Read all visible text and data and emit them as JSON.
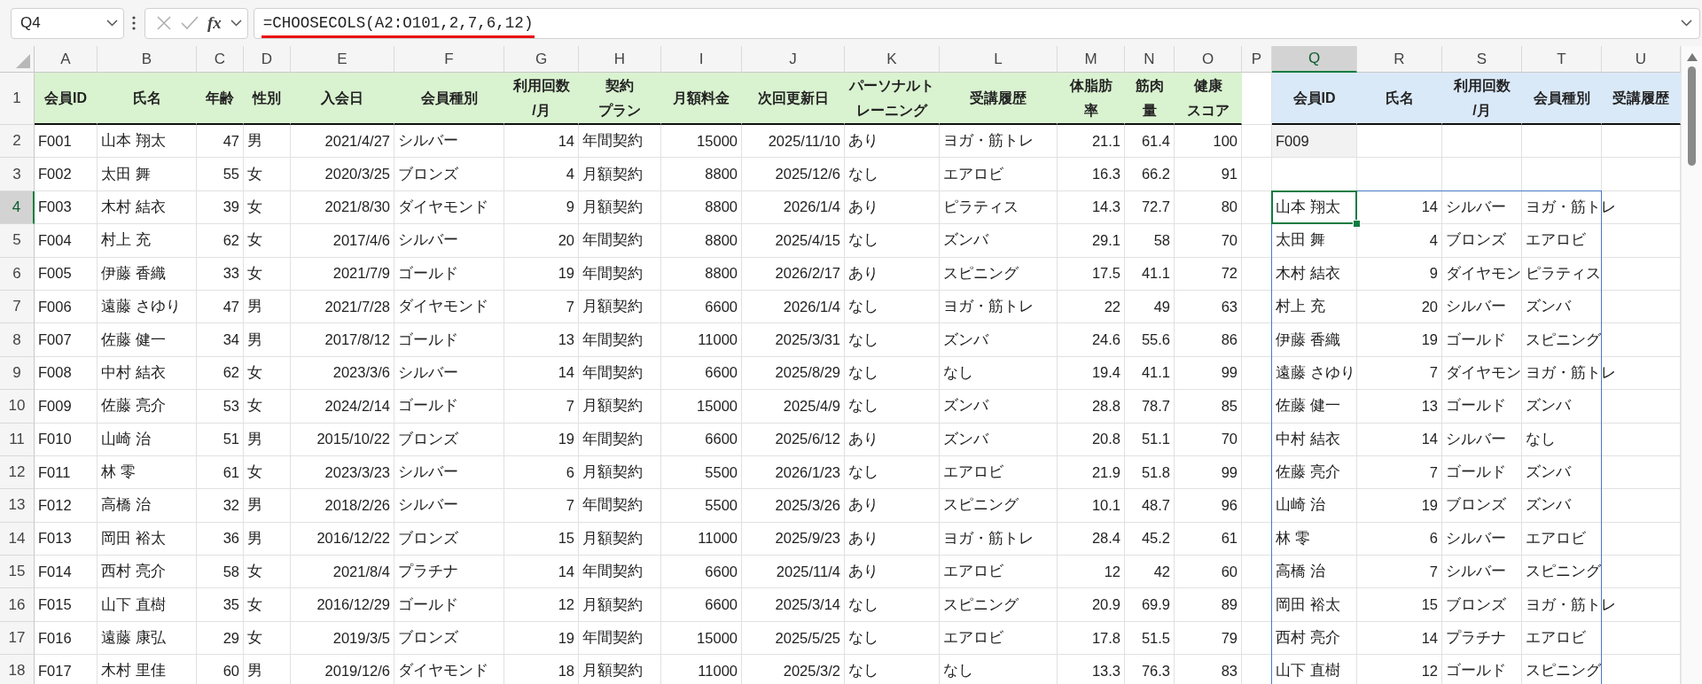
{
  "name_box": {
    "value": "Q4"
  },
  "formula_bar": {
    "function_label": "fx",
    "formula": "=CHOOSECOLS(A2:O101,2,7,6,12)",
    "underlined": true
  },
  "sheet": {
    "columns": [
      {
        "label": "A",
        "selected": false,
        "kind": "text",
        "color": "#d9f2d0"
      },
      {
        "label": "B",
        "selected": false,
        "kind": "text",
        "color": "#d9f2d0"
      },
      {
        "label": "C",
        "selected": false,
        "kind": "number",
        "color": "#d9f2d0"
      },
      {
        "label": "D",
        "selected": false,
        "kind": "text",
        "color": "#d9f2d0"
      },
      {
        "label": "E",
        "selected": false,
        "kind": "number",
        "color": "#d9f2d0"
      },
      {
        "label": "F",
        "selected": false,
        "kind": "text",
        "color": "#d9f2d0"
      },
      {
        "label": "G",
        "selected": false,
        "kind": "number",
        "color": "#d9f2d0"
      },
      {
        "label": "H",
        "selected": false,
        "kind": "text",
        "color": "#d9f2d0"
      },
      {
        "label": "I",
        "selected": false,
        "kind": "number",
        "color": "#d9f2d0"
      },
      {
        "label": "J",
        "selected": false,
        "kind": "number",
        "color": "#d9f2d0"
      },
      {
        "label": "K",
        "selected": false,
        "kind": "text",
        "color": "#d9f2d0"
      },
      {
        "label": "L",
        "selected": false,
        "kind": "text",
        "color": "#d9f2d0"
      },
      {
        "label": "M",
        "selected": false,
        "kind": "number",
        "color": "#d9f2d0"
      },
      {
        "label": "N",
        "selected": false,
        "kind": "number",
        "color": "#d9f2d0"
      },
      {
        "label": "O",
        "selected": false,
        "kind": "number",
        "color": "#d9f2d0"
      },
      {
        "label": "P",
        "selected": false,
        "kind": "text"
      },
      {
        "label": "Q",
        "selected": true,
        "kind": "text",
        "color": "#dae9f8"
      },
      {
        "label": "R",
        "selected": false,
        "kind": "number",
        "color": "#dae9f8"
      },
      {
        "label": "S",
        "selected": false,
        "kind": "text",
        "color": "#dae9f8"
      },
      {
        "label": "T",
        "selected": false,
        "kind": "text",
        "color": "#dae9f8"
      },
      {
        "label": "U",
        "selected": false,
        "kind": "text",
        "color": "#dae9f8"
      }
    ],
    "rows": [
      {
        "label": "1",
        "selected": false,
        "kind": "header",
        "spill": false,
        "cells": [
          "会員ID",
          "氏名",
          "年齢",
          "性別",
          "入会日",
          "会員種別",
          [
            "利用回数",
            "/月"
          ],
          [
            "契約",
            "プラン"
          ],
          "月額料金",
          "次回更新日",
          [
            "パーソナルト",
            "レーニング"
          ],
          "受講履歴",
          [
            "体脂肪",
            "率"
          ],
          [
            "筋肉",
            "量"
          ],
          [
            "健康",
            "スコア"
          ],
          null,
          "会員ID",
          "氏名",
          [
            "利用回数",
            "/月"
          ],
          "会員種別",
          "受講履歴"
        ]
      },
      {
        "label": "2",
        "selected": false,
        "kind": "data",
        "spill": false,
        "cells": [
          "F001",
          "山本 翔太",
          "47",
          "男",
          "2021/4/27",
          "シルバー",
          "14",
          "年間契約",
          "15000",
          "2025/11/10",
          "あり",
          "ヨガ・筋トレ",
          "21.1",
          "61.4",
          "100",
          null,
          {
            "text": "F009",
            "color": "#f2f2f2"
          },
          null,
          null,
          null,
          null
        ]
      },
      {
        "label": "3",
        "selected": false,
        "kind": "data",
        "spill": false,
        "cells": [
          "F002",
          "太田 舞",
          "55",
          "女",
          "2020/3/25",
          "ブロンズ",
          "4",
          "月額契約",
          "8800",
          "2025/12/6",
          "なし",
          "エアロビ",
          "16.3",
          "66.2",
          "91",
          null,
          null,
          null,
          null,
          null,
          null
        ]
      },
      {
        "label": "4",
        "selected": true,
        "kind": "data",
        "spill": true,
        "cells": [
          "F003",
          "木村 結衣",
          "39",
          "女",
          "2021/8/30",
          "ダイヤモンド",
          "9",
          "月額契約",
          "8800",
          "2026/1/4",
          "あり",
          "ピラティス",
          "14.3",
          "72.7",
          "80",
          null,
          "山本 翔太",
          "14",
          "シルバー",
          "ヨガ・筋トレ",
          null
        ]
      },
      {
        "label": "5",
        "selected": false,
        "kind": "data",
        "spill": true,
        "cells": [
          "F004",
          "村上 充",
          "62",
          "女",
          "2017/4/6",
          "シルバー",
          "20",
          "年間契約",
          "8800",
          "2025/4/15",
          "なし",
          "ズンバ",
          "29.1",
          "58",
          "70",
          null,
          "太田 舞",
          "4",
          "ブロンズ",
          "エアロビ",
          null
        ]
      },
      {
        "label": "6",
        "selected": false,
        "kind": "data",
        "spill": true,
        "cells": [
          "F005",
          "伊藤 香織",
          "33",
          "女",
          "2021/7/9",
          "ゴールド",
          "19",
          "年間契約",
          "8800",
          "2026/2/17",
          "あり",
          "スピニング",
          "17.5",
          "41.1",
          "72",
          null,
          "木村 結衣",
          "9",
          "ダイヤモン",
          "ピラティス",
          null
        ]
      },
      {
        "label": "7",
        "selected": false,
        "kind": "data",
        "spill": true,
        "cells": [
          "F006",
          "遠藤 さゆり",
          "47",
          "男",
          "2021/7/28",
          "ダイヤモンド",
          "7",
          "月額契約",
          "6600",
          "2026/1/4",
          "なし",
          "ヨガ・筋トレ",
          "22",
          "49",
          "63",
          null,
          "村上 充",
          "20",
          "シルバー",
          "ズンバ",
          null
        ]
      },
      {
        "label": "8",
        "selected": false,
        "kind": "data",
        "spill": true,
        "cells": [
          "F007",
          "佐藤 健一",
          "34",
          "男",
          "2017/8/12",
          "ゴールド",
          "13",
          "年間契約",
          "11000",
          "2025/3/31",
          "なし",
          "ズンバ",
          "24.6",
          "55.6",
          "86",
          null,
          "伊藤 香織",
          "19",
          "ゴールド",
          "スピニング",
          null
        ]
      },
      {
        "label": "9",
        "selected": false,
        "kind": "data",
        "spill": true,
        "cells": [
          "F008",
          "中村 結衣",
          "62",
          "女",
          "2023/3/6",
          "シルバー",
          "14",
          "年間契約",
          "6600",
          "2025/8/29",
          "なし",
          "なし",
          "19.4",
          "41.1",
          "99",
          null,
          "遠藤 さゆり",
          "7",
          "ダイヤモン",
          "ヨガ・筋トレ",
          null
        ]
      },
      {
        "label": "10",
        "selected": false,
        "kind": "data",
        "spill": true,
        "cells": [
          "F009",
          "佐藤 亮介",
          "53",
          "女",
          "2024/2/14",
          "ゴールド",
          "7",
          "月額契約",
          "15000",
          "2025/4/9",
          "なし",
          "ズンバ",
          "28.8",
          "78.7",
          "85",
          null,
          "佐藤 健一",
          "13",
          "ゴールド",
          "ズンバ",
          null
        ]
      },
      {
        "label": "11",
        "selected": false,
        "kind": "data",
        "spill": true,
        "cells": [
          "F010",
          "山崎 治",
          "51",
          "男",
          "2015/10/22",
          "ブロンズ",
          "19",
          "年間契約",
          "6600",
          "2025/6/12",
          "あり",
          "ズンバ",
          "20.8",
          "51.1",
          "70",
          null,
          "中村 結衣",
          "14",
          "シルバー",
          "なし",
          null
        ]
      },
      {
        "label": "12",
        "selected": false,
        "kind": "data",
        "spill": true,
        "cells": [
          "F011",
          "林 零",
          "61",
          "女",
          "2023/3/23",
          "シルバー",
          "6",
          "月額契約",
          "5500",
          "2026/1/23",
          "なし",
          "エアロビ",
          "21.9",
          "51.8",
          "99",
          null,
          "佐藤 亮介",
          "7",
          "ゴールド",
          "ズンバ",
          null
        ]
      },
      {
        "label": "13",
        "selected": false,
        "kind": "data",
        "spill": true,
        "cells": [
          "F012",
          "高橋 治",
          "32",
          "男",
          "2018/2/26",
          "シルバー",
          "7",
          "年間契約",
          "5500",
          "2025/3/26",
          "あり",
          "スピニング",
          "10.1",
          "48.7",
          "96",
          null,
          "山崎 治",
          "19",
          "ブロンズ",
          "ズンバ",
          null
        ]
      },
      {
        "label": "14",
        "selected": false,
        "kind": "data",
        "spill": true,
        "cells": [
          "F013",
          "岡田 裕太",
          "36",
          "男",
          "2016/12/22",
          "ブロンズ",
          "15",
          "月額契約",
          "11000",
          "2025/9/23",
          "あり",
          "ヨガ・筋トレ",
          "28.4",
          "45.2",
          "61",
          null,
          "林 零",
          "6",
          "シルバー",
          "エアロビ",
          null
        ]
      },
      {
        "label": "15",
        "selected": false,
        "kind": "data",
        "spill": true,
        "cells": [
          "F014",
          "西村 亮介",
          "58",
          "女",
          "2021/8/4",
          "プラチナ",
          "14",
          "年間契約",
          "6600",
          "2025/11/4",
          "あり",
          "エアロビ",
          "12",
          "42",
          "60",
          null,
          "高橋 治",
          "7",
          "シルバー",
          "スピニング",
          null
        ]
      },
      {
        "label": "16",
        "selected": false,
        "kind": "data",
        "spill": true,
        "cells": [
          "F015",
          "山下 直樹",
          "35",
          "女",
          "2016/12/29",
          "ゴールド",
          "12",
          "月額契約",
          "6600",
          "2025/3/14",
          "なし",
          "スピニング",
          "20.9",
          "69.9",
          "89",
          null,
          "岡田 裕太",
          "15",
          "ブロンズ",
          "ヨガ・筋トレ",
          null
        ]
      },
      {
        "label": "17",
        "selected": false,
        "kind": "data",
        "spill": true,
        "cells": [
          "F016",
          "遠藤 康弘",
          "29",
          "女",
          "2019/3/5",
          "ブロンズ",
          "19",
          "年間契約",
          "15000",
          "2025/5/25",
          "なし",
          "エアロビ",
          "17.8",
          "51.5",
          "79",
          null,
          "西村 亮介",
          "14",
          "プラチナ",
          "エアロビ",
          null
        ]
      },
      {
        "label": "18",
        "selected": false,
        "kind": "data",
        "spill": true,
        "cells": [
          "F017",
          "木村 里佳",
          "60",
          "男",
          "2019/12/6",
          "ダイヤモンド",
          "18",
          "月額契約",
          "11000",
          "2025/3/2",
          "なし",
          "なし",
          "13.3",
          "76.3",
          "83",
          null,
          "山下 直樹",
          "12",
          "ゴールド",
          "スピニング",
          null
        ]
      }
    ]
  }
}
